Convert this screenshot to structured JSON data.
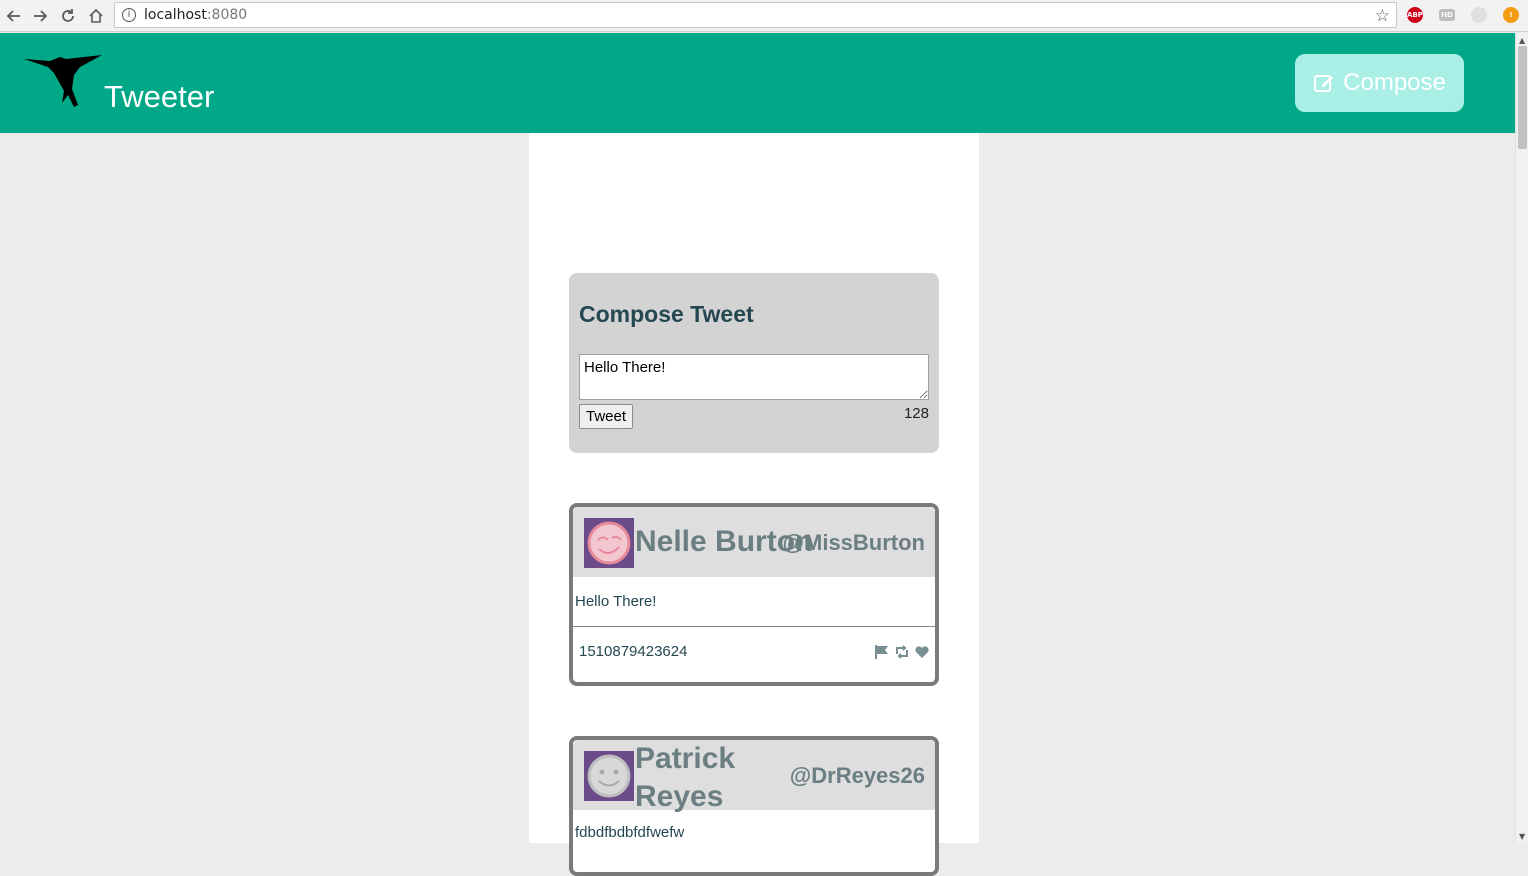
{
  "browser": {
    "url_host": "localhost",
    "url_port": ":8080"
  },
  "header": {
    "brand": "Tweeter",
    "compose_label": "Compose"
  },
  "compose": {
    "title": "Compose Tweet",
    "input_value": "Hello There!",
    "submit_label": "Tweet",
    "char_count": "128"
  },
  "tweets": [
    {
      "name": "Nelle Burton",
      "handle": "@MissBurton",
      "body": "Hello There!",
      "timestamp": "1510879423624"
    },
    {
      "name_line1": "Patrick",
      "name_line2": "Reyes",
      "handle": "@DrReyes26",
      "body": "fdbdfbdbfdfwefw"
    }
  ],
  "colors": {
    "header_bg": "#00a887",
    "compose_btn_bg": "#a9efe6",
    "panel_bg": "#d3d3d3",
    "title_text": "#244751",
    "author_text": "#6b7e82"
  },
  "icons": {
    "back": "back-arrow-icon",
    "forward": "forward-arrow-icon",
    "reload": "reload-icon",
    "home": "home-icon",
    "bookmark": "star-icon",
    "compose": "edit-icon",
    "flag": "flag-icon",
    "retweet": "retweet-icon",
    "like": "heart-icon"
  }
}
